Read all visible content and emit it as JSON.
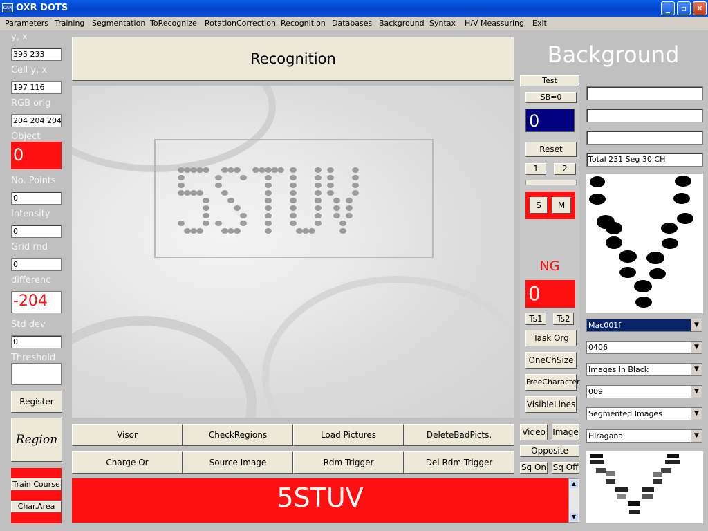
{
  "window": {
    "title": "OXR DOTS",
    "icon": "oxr-app-icon",
    "icon_text": "OXR",
    "minimize": "_",
    "maximize": "▫",
    "close": "✕"
  },
  "menu": [
    "Parameters",
    "Training",
    "Segmentation",
    "ToRecognize",
    "RotationCorrection",
    "Recognition",
    "Databases",
    "Background",
    "Syntax",
    "H/V Meassuring",
    "Exit"
  ],
  "left_panel": {
    "yx_label": "y, x",
    "yx_value": "395 233",
    "cell_label": "Cell y, x",
    "cell_value": "197 116",
    "rgb_label": "RGB orig",
    "rgb_value": "204 204 204",
    "object_label": "Object",
    "object_value": "0",
    "points_label": "No. Points",
    "points_value": "0",
    "intensity_label": "Intensity",
    "intensity_value": "0",
    "grid_label": "Grid rnd",
    "grid_value": "0",
    "diff_label": "differenc",
    "diff_value": "-204",
    "std_label": "Std dev",
    "std_value": "0",
    "threshold_label": "Threshold",
    "threshold_value": "",
    "register_button": "Register",
    "region_button": "Region",
    "train_course_button": "Train Course",
    "char_area_button": "Char.Area"
  },
  "header_button": "Recognition",
  "viewer": {
    "text": "5STUV"
  },
  "bottom_buttons": {
    "row1": [
      "Visor",
      "CheckRegions",
      "Load Pictures",
      "DeleteBadPicts."
    ],
    "row2": [
      "Charge Or",
      "Source Image",
      "Rdm Trigger",
      "Del Rdm Trigger"
    ]
  },
  "result_text": "5STUV",
  "middle_panel": {
    "test_button": "Test",
    "sb_button": "SB=0",
    "sb_value": "0",
    "reset_button": "Reset",
    "btn_1": "1",
    "btn_2": "2",
    "s_button": "S",
    "m_button": "M",
    "ng_label": "NG",
    "ng_value": "0",
    "ts1_button": "Ts1",
    "ts2_button": "Ts2",
    "task_org_button": "Task Org",
    "one_ch_size_button": "OneChSize",
    "free_character_button": "FreeCharacter",
    "visible_lines_button": "VisibleLines",
    "video_button": "Video",
    "image_button": "Image",
    "opposite_button": "Opposite",
    "sq_on_button": "Sq On",
    "sq_off_button": "Sq Off"
  },
  "right_panel": {
    "title": "Background",
    "field1": "",
    "field2": "",
    "field3": "",
    "total_field": "Total 231   Seg 30   CH",
    "selects": [
      "Mac001f",
      "0406",
      "Images In Black",
      "009",
      "Segmented Images",
      "Hiragana"
    ]
  },
  "colors": {
    "red": "#ff1010",
    "navy": "#000080",
    "face": "#ece9d8",
    "bg": "#c0c0c0"
  }
}
